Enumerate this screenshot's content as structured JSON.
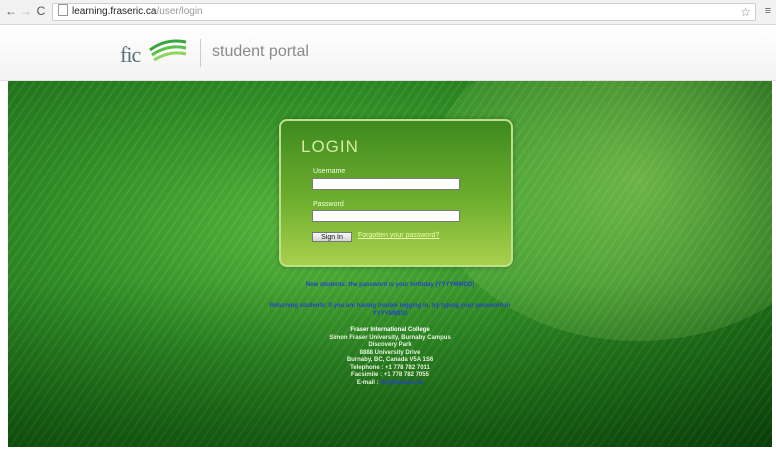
{
  "browser": {
    "url_host": "learning.fraseric.ca",
    "url_path": "/user/login",
    "back_glyph": "←",
    "forward_glyph": "→",
    "reload_glyph": "C",
    "star_glyph": "☆",
    "menu_glyph": "≡"
  },
  "header": {
    "logo_text": "fic",
    "portal_label": "student portal"
  },
  "login": {
    "title": "LOGIN",
    "username_label": "Username",
    "username_value": "",
    "password_label": "Password",
    "password_value": "",
    "signin_label": "Sign In",
    "forgot_link": "Forgotten your password?"
  },
  "notices": {
    "new_students": "New students: the password is your birthday (YYYYMMDD)",
    "returning_students": "Returning students: if you are having trouble logging in, try typing your password in YYYYMMDD"
  },
  "contact": {
    "name": "Fraser International College",
    "line1": "Simon Fraser University, Burnaby Campus",
    "line2": "Discovery Park",
    "line3": "8888 University Drive",
    "line4": "Burnaby, BC, Canada V5A 1S6",
    "phone": "Telephone : +1 778 782 7011",
    "fax": "Facsimile : +1 778 782 7055",
    "email_label": "E-mail :",
    "email_value": "fic@fraseric.ca"
  },
  "colors": {
    "accent_green": "#2f8d25",
    "link_blue": "#2444c8"
  }
}
